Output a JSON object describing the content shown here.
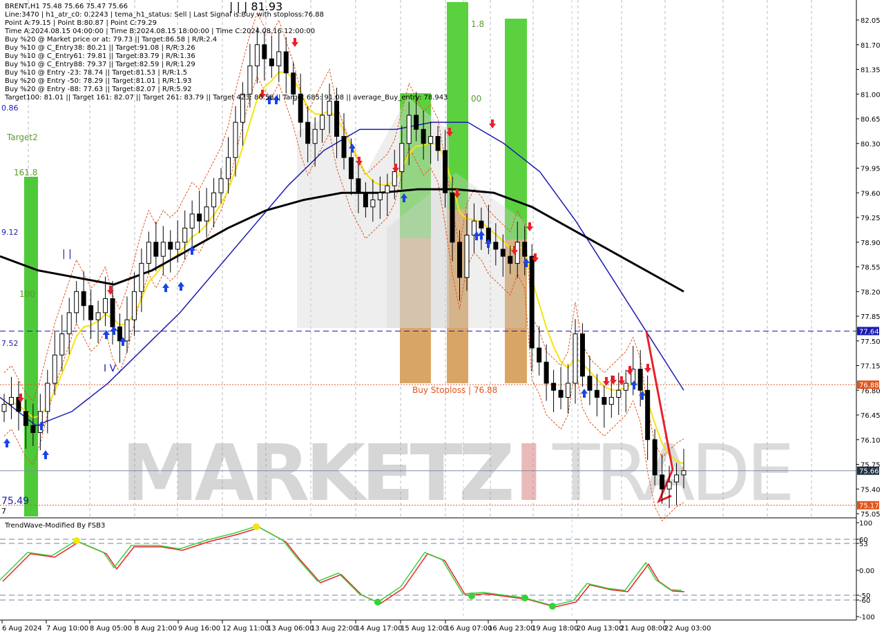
{
  "header": {
    "lines": [
      "BRENT,H1  75.48 75.66 75.47 75.66",
      "Line:3470 | h1_atr_c0: 0.2243 | tema_h1_status: Sell | Last Signal is:Buy with stoploss:76.88",
      "Point A:79.15 | Point B:80.87 | Point C:79.29",
      "Time A:2024.08.15 04:00:00 | Time B:2024.08.15 18:00:00 | Time C:2024.08.16 12:00:00",
      "Buy %20 @ Market price or at: 79.73 || Target:86.58 | R/R:2.4",
      "Buy %10 @ C_Entry38: 80.21 || Target:91.08 | R/R:3.26",
      "Buy %10 @ C_Entry61: 79.81 || Target:83.79 | R/R:1.36",
      "Buy %10 @ C_Entry88: 79.37 || Target:82.59 | R/R:1.29",
      "Buy %10 @ Entry -23: 78.74 || Target:81.53 | R/R:1.5",
      "Buy %20 @ Entry -50: 78.29 || Target:81.01 | R/R:1.93",
      "Buy %20 @ Entry -88: 77.63 || Target:82.07 | R/R:5.92",
      "Target100: 81.01 || Target 161: 82.07 || Target 261: 83.79 || Target 423: 86.58 || Target 685: 91.08 || average_Buy_entry: 78.943"
    ]
  },
  "labels": {
    "wave_top": "| | | 81.93",
    "wave_I": "| |",
    "wave_IV": "I V",
    "target2": "Target2",
    "fib1618": "161.8",
    "fib100": "100",
    "lvl_18": "1.8",
    "lvl_00": "00",
    "left_086": "0.86",
    "left_912": "9.12",
    "left_752": "7.52",
    "left_7549": "75.49",
    "left_7": "7",
    "buy_stoploss": "Buy Stoploss | 76.88",
    "watermark": "MARKETZ",
    "watermark_i": "I",
    "watermark2": "TRADE"
  },
  "indicator": {
    "name": "TrendWave-Modified By FSB3",
    "ticks": [
      "100",
      "60",
      "53",
      "0.00",
      "-50",
      "-60",
      "-100"
    ]
  },
  "price_axis": {
    "ticks": [
      "82.05",
      "81.70",
      "81.35",
      "81.00",
      "80.65",
      "80.30",
      "79.95",
      "79.60",
      "79.25",
      "78.90",
      "78.55",
      "78.20",
      "77.85",
      "77.50",
      "77.15",
      "76.80",
      "76.45",
      "76.10",
      "75.75",
      "75.40",
      "75.05"
    ],
    "marker_blue": "77.64",
    "marker_red_top": "76.88",
    "marker_current": "75.66",
    "marker_red_bottom": "75.17"
  },
  "time_axis": [
    "6 Aug 2024",
    "7 Aug 10:00",
    "8 Aug 05:00",
    "8 Aug 21:00",
    "9 Aug 16:00",
    "12 Aug 11:00",
    "13 Aug 06:00",
    "13 Aug 22:00",
    "14 Aug 17:00",
    "15 Aug 12:00",
    "16 Aug 07:00",
    "16 Aug 23:00",
    "19 Aug 18:00",
    "20 Aug 13:00",
    "21 Aug 08:00",
    "22 Aug 03:00"
  ],
  "chart_data": {
    "type": "candlestick",
    "symbol": "BRENT,H1",
    "ylim": [
      75.0,
      82.2
    ],
    "current_price": 75.66,
    "close": [
      76.6,
      76.7,
      76.5,
      76.3,
      76.2,
      76.5,
      76.9,
      77.3,
      77.6,
      77.9,
      78.2,
      78.0,
      77.8,
      77.9,
      78.1,
      77.7,
      77.5,
      77.8,
      78.2,
      78.6,
      78.9,
      78.7,
      78.9,
      78.8,
      78.9,
      79.1,
      79.3,
      79.2,
      79.4,
      79.6,
      79.8,
      80.1,
      80.6,
      81.0,
      81.4,
      81.7,
      81.5,
      81.4,
      81.6,
      81.3,
      81.0,
      80.6,
      80.3,
      80.5,
      80.7,
      80.9,
      80.4,
      80.1,
      79.8,
      79.6,
      79.4,
      79.5,
      79.6,
      79.7,
      79.9,
      80.3,
      80.7,
      80.5,
      80.3,
      80.4,
      80.2,
      79.6,
      78.9,
      78.4,
      79.0,
      79.2,
      79.1,
      78.9,
      78.8,
      78.7,
      78.6,
      78.9,
      78.7,
      77.4,
      77.2,
      76.9,
      76.8,
      76.7,
      76.9,
      77.6,
      77.0,
      76.8,
      76.7,
      76.6,
      76.7,
      76.8,
      76.9,
      77.1,
      76.8,
      76.1,
      75.6,
      75.4,
      75.5,
      75.6,
      75.66
    ],
    "ema_fast_black": [
      78.7,
      78.5,
      78.4,
      78.3,
      78.5,
      78.8,
      79.1,
      79.35,
      79.5,
      79.6,
      79.6,
      79.65,
      79.65,
      79.6,
      79.4,
      79.1,
      78.8,
      78.5,
      78.2
    ],
    "ma_slow_blue": [
      76.7,
      76.3,
      76.5,
      76.9,
      77.4,
      77.9,
      78.5,
      79.1,
      79.7,
      80.2,
      80.5,
      80.5,
      80.6,
      80.6,
      80.3,
      79.9,
      79.2,
      78.4,
      77.6,
      76.8
    ]
  }
}
